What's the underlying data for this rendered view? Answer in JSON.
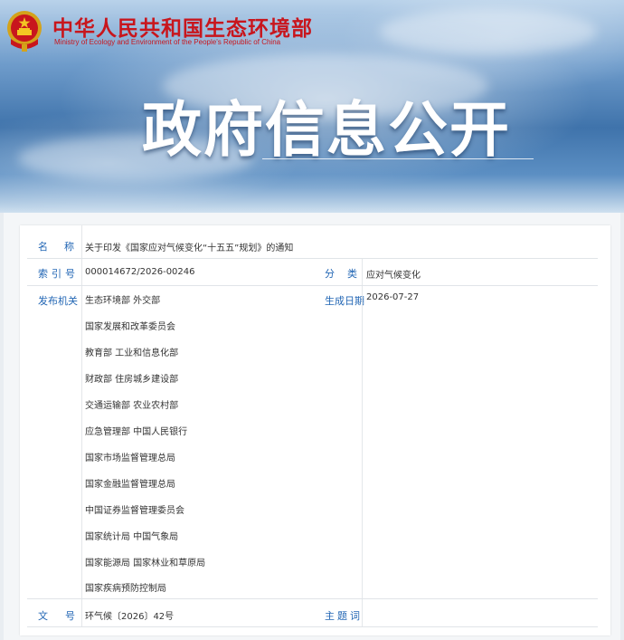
{
  "header": {
    "site_title": "中华人民共和国生态环境部",
    "site_subtitle": "Ministry of Ecology and Environment of the People's Republic of China",
    "banner_title": "政府信息公开"
  },
  "info": {
    "name_label": "名称",
    "name_value": "关于印发《国家应对气候变化“十五五”规划》的通知",
    "index_label": "索引号",
    "index_value": "000014672/2026-00246",
    "category_label": "分类",
    "category_value": "应对气候变化",
    "issuer_label": "发布机关",
    "issuers": [
      "生态环境部 外交部",
      "国家发展和改革委员会",
      "教育部 工业和信息化部",
      "财政部 住房城乡建设部",
      "交通运输部 农业农村部",
      "应急管理部 中国人民银行",
      "国家市场监督管理总局",
      "国家金融监督管理总局",
      "中国证券监督管理委员会",
      "国家统计局 中国气象局",
      "国家能源局 国家林业和草原局",
      "国家疾病预防控制局"
    ],
    "date_label": "生成日期",
    "date_value": "2026-07-27",
    "docno_label": "文号",
    "docno_value": "环气候〔2026〕42号",
    "keywords_label": "主题词",
    "keywords_value": ""
  },
  "colors": {
    "site_title": "#c8161d",
    "label_blue": "#2266b4",
    "banner_blue": "#3f73ab"
  }
}
